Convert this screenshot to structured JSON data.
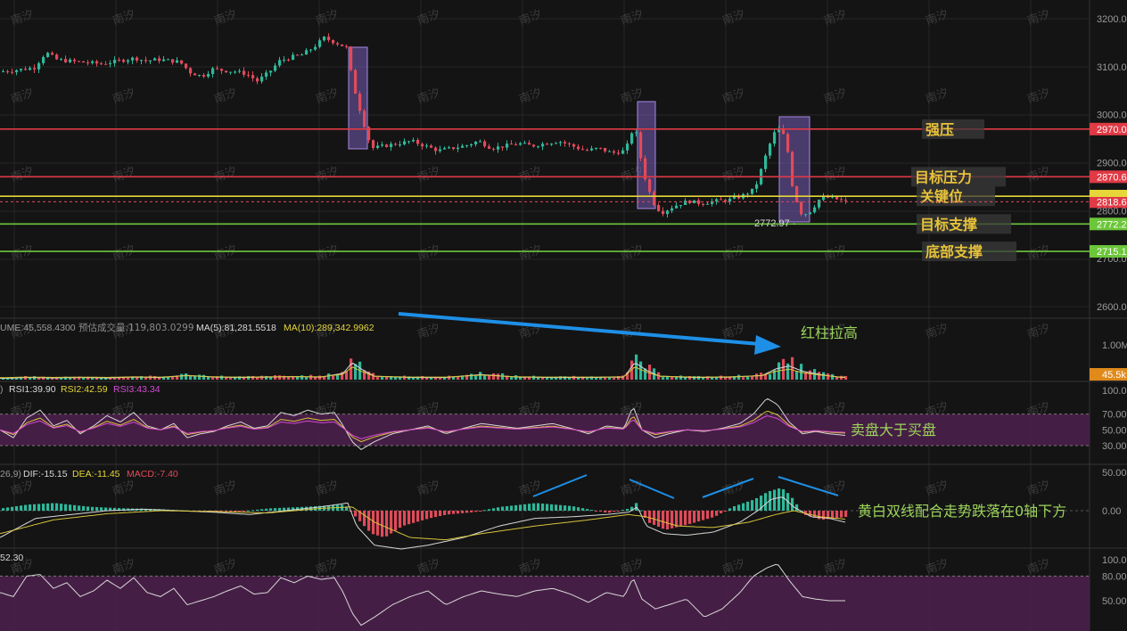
{
  "watermark_text": "南汐",
  "colors": {
    "background": "#141414",
    "up": "#2fb89a",
    "down": "#e04b5a",
    "resistance": "#e03a45",
    "key_level": "#e6d63a",
    "support": "#6cc63a",
    "box_fill": "#8a6ad4",
    "arrow": "#1e8fe6",
    "rsi_band": "#4a1f4a",
    "annotation": "#e8c23a",
    "note_text": "#9bd45a",
    "axis_text": "#9a9a9a",
    "ma_yellow": "#d6c43a",
    "ma_white": "#d8d8d8"
  },
  "main_axis": {
    "ticks": [
      "3200.0",
      "3100.0",
      "3000.0",
      "2900.0",
      "2800.0",
      "2700.0",
      "2600.0"
    ]
  },
  "price_tags": [
    {
      "text": "2970.0",
      "color": "#e03a45"
    },
    {
      "text": "2870.6",
      "color": "#e03a45"
    },
    {
      "text": "2818.6",
      "color": "#e03a45"
    },
    {
      "text": "2772.2",
      "color": "#6cc63a"
    },
    {
      "text": "2715.1",
      "color": "#6cc63a"
    }
  ],
  "levels": [
    {
      "label": "强压",
      "price": 2970.0,
      "color": "#e03a45"
    },
    {
      "label": "目标压力",
      "price": 2870.6,
      "color": "#e03a45"
    },
    {
      "label": "关键位",
      "price": 2830.0,
      "color": "#e6d63a"
    },
    {
      "label": "目标支撑",
      "price": 2772.2,
      "color": "#6cc63a"
    },
    {
      "label": "底部支撑",
      "price": 2715.1,
      "color": "#6cc63a"
    }
  ],
  "low_marker": "2772.97",
  "volume": {
    "header": {
      "prefix": "UME:45,558.4300",
      "estimate": "预估成交量:119,803.0299",
      "ma5": "MA(5):81,281.5518",
      "ma10": "MA(10):289,342.9962"
    },
    "axis_ticks": [
      "1.00M"
    ],
    "current_tag": "45.5k",
    "note": "红柱拉高"
  },
  "rsi": {
    "header": {
      "prefix": ")",
      "rsi1": "RSI1:39.90",
      "rsi2": "RSI2:42.59",
      "rsi3": "RSI3:43.34"
    },
    "axis_ticks": [
      "100.00",
      "70.00",
      "50.00",
      "30.00"
    ],
    "note": "卖盘大于买盘"
  },
  "macd": {
    "header": {
      "prefix": "26,9)",
      "dif": "DIF:-15.15",
      "dea": "DEA:-11.45",
      "macd": "MACD:-7.40"
    },
    "axis_ticks": [
      "50.00",
      "0.00"
    ],
    "note": "黄白双线配合走势跌落在0轴下方"
  },
  "osc": {
    "header_value": "52.30",
    "axis_ticks": [
      "100.00",
      "80.00",
      "50.00"
    ]
  },
  "chart_data": {
    "type": "candlestick",
    "price_range": [
      2600,
      3200
    ],
    "price_path": [
      [
        0,
        3090
      ],
      [
        12,
        3092
      ],
      [
        25,
        3095
      ],
      [
        37,
        3098
      ],
      [
        50,
        3130
      ],
      [
        62,
        3115
      ],
      [
        75,
        3112
      ],
      [
        87,
        3110
      ],
      [
        100,
        3108
      ],
      [
        112,
        3106
      ],
      [
        125,
        3110
      ],
      [
        137,
        3114
      ],
      [
        150,
        3118
      ],
      [
        162,
        3112
      ],
      [
        175,
        3115
      ],
      [
        187,
        3113
      ],
      [
        200,
        3110
      ],
      [
        212,
        3088
      ],
      [
        225,
        3080
      ],
      [
        237,
        3095
      ],
      [
        250,
        3092
      ],
      [
        262,
        3090
      ],
      [
        275,
        3085
      ],
      [
        287,
        3070
      ],
      [
        300,
        3088
      ],
      [
        312,
        3112
      ],
      [
        325,
        3120
      ],
      [
        337,
        3125
      ],
      [
        350,
        3140
      ],
      [
        362,
        3160
      ],
      [
        375,
        3150
      ],
      [
        387,
        3140
      ],
      [
        395,
        3060
      ],
      [
        405,
        2990
      ],
      [
        415,
        2930
      ],
      [
        430,
        2935
      ],
      [
        445,
        2940
      ],
      [
        460,
        2945
      ],
      [
        475,
        2935
      ],
      [
        490,
        2925
      ],
      [
        505,
        2930
      ],
      [
        520,
        2935
      ],
      [
        535,
        2945
      ],
      [
        550,
        2930
      ],
      [
        565,
        2935
      ],
      [
        580,
        2940
      ],
      [
        595,
        2935
      ],
      [
        610,
        2940
      ],
      [
        625,
        2945
      ],
      [
        640,
        2935
      ],
      [
        655,
        2925
      ],
      [
        670,
        2930
      ],
      [
        685,
        2920
      ],
      [
        700,
        2925
      ],
      [
        710,
        2980
      ],
      [
        720,
        2880
      ],
      [
        730,
        2820
      ],
      [
        740,
        2795
      ],
      [
        755,
        2810
      ],
      [
        770,
        2820
      ],
      [
        785,
        2815
      ],
      [
        800,
        2820
      ],
      [
        815,
        2822
      ],
      [
        830,
        2830
      ],
      [
        845,
        2845
      ],
      [
        860,
        2930
      ],
      [
        870,
        2975
      ],
      [
        880,
        2950
      ],
      [
        888,
        2840
      ],
      [
        898,
        2790
      ],
      [
        908,
        2800
      ],
      [
        918,
        2825
      ],
      [
        930,
        2828
      ],
      [
        940,
        2822
      ],
      [
        948,
        2818
      ]
    ],
    "volume_series": [
      [
        0,
        0.03
      ],
      [
        30,
        0.05
      ],
      [
        60,
        0.04
      ],
      [
        90,
        0.05
      ],
      [
        120,
        0.04
      ],
      [
        150,
        0.06
      ],
      [
        180,
        0.05
      ],
      [
        210,
        0.1
      ],
      [
        240,
        0.06
      ],
      [
        270,
        0.05
      ],
      [
        300,
        0.06
      ],
      [
        330,
        0.07
      ],
      [
        360,
        0.06
      ],
      [
        385,
        0.15
      ],
      [
        395,
        0.4
      ],
      [
        405,
        0.25
      ],
      [
        420,
        0.08
      ],
      [
        460,
        0.05
      ],
      [
        500,
        0.05
      ],
      [
        540,
        0.12
      ],
      [
        580,
        0.06
      ],
      [
        620,
        0.05
      ],
      [
        660,
        0.05
      ],
      [
        700,
        0.06
      ],
      [
        712,
        0.4
      ],
      [
        725,
        0.22
      ],
      [
        740,
        0.08
      ],
      [
        780,
        0.05
      ],
      [
        820,
        0.06
      ],
      [
        855,
        0.1
      ],
      [
        870,
        0.25
      ],
      [
        885,
        0.32
      ],
      [
        900,
        0.2
      ],
      [
        920,
        0.12
      ],
      [
        940,
        0.06
      ],
      [
        948,
        0.05
      ]
    ],
    "rsi_series": [
      [
        0,
        50
      ],
      [
        15,
        40
      ],
      [
        30,
        65
      ],
      [
        45,
        75
      ],
      [
        60,
        55
      ],
      [
        75,
        62
      ],
      [
        90,
        45
      ],
      [
        105,
        55
      ],
      [
        120,
        68
      ],
      [
        135,
        60
      ],
      [
        150,
        72
      ],
      [
        165,
        55
      ],
      [
        180,
        50
      ],
      [
        195,
        58
      ],
      [
        210,
        40
      ],
      [
        225,
        45
      ],
      [
        240,
        48
      ],
      [
        255,
        55
      ],
      [
        270,
        60
      ],
      [
        285,
        52
      ],
      [
        300,
        55
      ],
      [
        315,
        72
      ],
      [
        330,
        68
      ],
      [
        345,
        75
      ],
      [
        360,
        70
      ],
      [
        375,
        72
      ],
      [
        385,
        55
      ],
      [
        395,
        35
      ],
      [
        405,
        25
      ],
      [
        420,
        35
      ],
      [
        440,
        45
      ],
      [
        460,
        50
      ],
      [
        480,
        55
      ],
      [
        500,
        45
      ],
      [
        520,
        52
      ],
      [
        540,
        58
      ],
      [
        560,
        55
      ],
      [
        580,
        52
      ],
      [
        600,
        55
      ],
      [
        620,
        58
      ],
      [
        640,
        52
      ],
      [
        660,
        45
      ],
      [
        680,
        55
      ],
      [
        700,
        52
      ],
      [
        710,
        80
      ],
      [
        720,
        50
      ],
      [
        735,
        40
      ],
      [
        750,
        45
      ],
      [
        770,
        50
      ],
      [
        790,
        48
      ],
      [
        810,
        52
      ],
      [
        830,
        58
      ],
      [
        845,
        70
      ],
      [
        860,
        90
      ],
      [
        872,
        82
      ],
      [
        885,
        60
      ],
      [
        900,
        45
      ],
      [
        915,
        48
      ],
      [
        930,
        45
      ],
      [
        948,
        43
      ]
    ],
    "macd_dif_series": [
      [
        0,
        -35
      ],
      [
        40,
        -10
      ],
      [
        80,
        -5
      ],
      [
        120,
        0
      ],
      [
        160,
        2
      ],
      [
        200,
        0
      ],
      [
        240,
        -2
      ],
      [
        280,
        -5
      ],
      [
        320,
        0
      ],
      [
        360,
        5
      ],
      [
        390,
        10
      ],
      [
        400,
        -20
      ],
      [
        420,
        -45
      ],
      [
        450,
        -50
      ],
      [
        480,
        -45
      ],
      [
        520,
        -35
      ],
      [
        560,
        -20
      ],
      [
        600,
        -10
      ],
      [
        640,
        -8
      ],
      [
        680,
        -5
      ],
      [
        705,
        -2
      ],
      [
        715,
        5
      ],
      [
        725,
        -20
      ],
      [
        745,
        -30
      ],
      [
        770,
        -32
      ],
      [
        800,
        -28
      ],
      [
        830,
        -15
      ],
      [
        850,
        0
      ],
      [
        865,
        15
      ],
      [
        878,
        18
      ],
      [
        890,
        5
      ],
      [
        910,
        -8
      ],
      [
        930,
        -10
      ],
      [
        948,
        -15
      ]
    ],
    "macd_dea_series": [
      [
        0,
        -30
      ],
      [
        60,
        -12
      ],
      [
        120,
        -4
      ],
      [
        180,
        0
      ],
      [
        240,
        -1
      ],
      [
        300,
        -3
      ],
      [
        360,
        3
      ],
      [
        395,
        5
      ],
      [
        420,
        -15
      ],
      [
        460,
        -35
      ],
      [
        500,
        -38
      ],
      [
        540,
        -30
      ],
      [
        600,
        -20
      ],
      [
        660,
        -12
      ],
      [
        705,
        -5
      ],
      [
        725,
        -8
      ],
      [
        760,
        -20
      ],
      [
        800,
        -22
      ],
      [
        840,
        -15
      ],
      [
        870,
        -5
      ],
      [
        890,
        0
      ],
      [
        920,
        -8
      ],
      [
        948,
        -11
      ]
    ],
    "macd_hist_series": [
      [
        0,
        3
      ],
      [
        30,
        8
      ],
      [
        60,
        10
      ],
      [
        100,
        5
      ],
      [
        140,
        3
      ],
      [
        180,
        2
      ],
      [
        220,
        -1
      ],
      [
        260,
        -2
      ],
      [
        300,
        3
      ],
      [
        340,
        5
      ],
      [
        385,
        8
      ],
      [
        395,
        -5
      ],
      [
        415,
        -30
      ],
      [
        430,
        -35
      ],
      [
        450,
        -20
      ],
      [
        480,
        -10
      ],
      [
        500,
        -5
      ],
      [
        530,
        -2
      ],
      [
        560,
        5
      ],
      [
        600,
        10
      ],
      [
        640,
        6
      ],
      [
        680,
        -3
      ],
      [
        705,
        3
      ],
      [
        712,
        10
      ],
      [
        725,
        -15
      ],
      [
        745,
        -25
      ],
      [
        770,
        -18
      ],
      [
        800,
        -8
      ],
      [
        820,
        5
      ],
      [
        845,
        15
      ],
      [
        860,
        25
      ],
      [
        875,
        30
      ],
      [
        885,
        20
      ],
      [
        900,
        -5
      ],
      [
        920,
        -12
      ],
      [
        948,
        -8
      ]
    ],
    "osc_series": [
      [
        0,
        60
      ],
      [
        15,
        55
      ],
      [
        30,
        80
      ],
      [
        45,
        82
      ],
      [
        60,
        65
      ],
      [
        75,
        72
      ],
      [
        90,
        55
      ],
      [
        105,
        62
      ],
      [
        120,
        75
      ],
      [
        135,
        65
      ],
      [
        150,
        78
      ],
      [
        165,
        60
      ],
      [
        180,
        55
      ],
      [
        195,
        65
      ],
      [
        210,
        45
      ],
      [
        225,
        50
      ],
      [
        240,
        55
      ],
      [
        255,
        62
      ],
      [
        270,
        68
      ],
      [
        285,
        58
      ],
      [
        300,
        60
      ],
      [
        315,
        78
      ],
      [
        330,
        72
      ],
      [
        345,
        80
      ],
      [
        360,
        76
      ],
      [
        375,
        78
      ],
      [
        385,
        60
      ],
      [
        395,
        35
      ],
      [
        405,
        20
      ],
      [
        420,
        30
      ],
      [
        440,
        45
      ],
      [
        460,
        55
      ],
      [
        480,
        62
      ],
      [
        500,
        45
      ],
      [
        520,
        55
      ],
      [
        540,
        62
      ],
      [
        560,
        58
      ],
      [
        580,
        55
      ],
      [
        600,
        62
      ],
      [
        620,
        65
      ],
      [
        640,
        58
      ],
      [
        660,
        48
      ],
      [
        680,
        60
      ],
      [
        700,
        55
      ],
      [
        710,
        78
      ],
      [
        720,
        52
      ],
      [
        735,
        40
      ],
      [
        750,
        45
      ],
      [
        770,
        52
      ],
      [
        790,
        30
      ],
      [
        810,
        40
      ],
      [
        830,
        60
      ],
      [
        845,
        80
      ],
      [
        860,
        90
      ],
      [
        872,
        95
      ],
      [
        885,
        75
      ],
      [
        900,
        55
      ],
      [
        915,
        52
      ],
      [
        930,
        50
      ],
      [
        948,
        50
      ]
    ]
  }
}
